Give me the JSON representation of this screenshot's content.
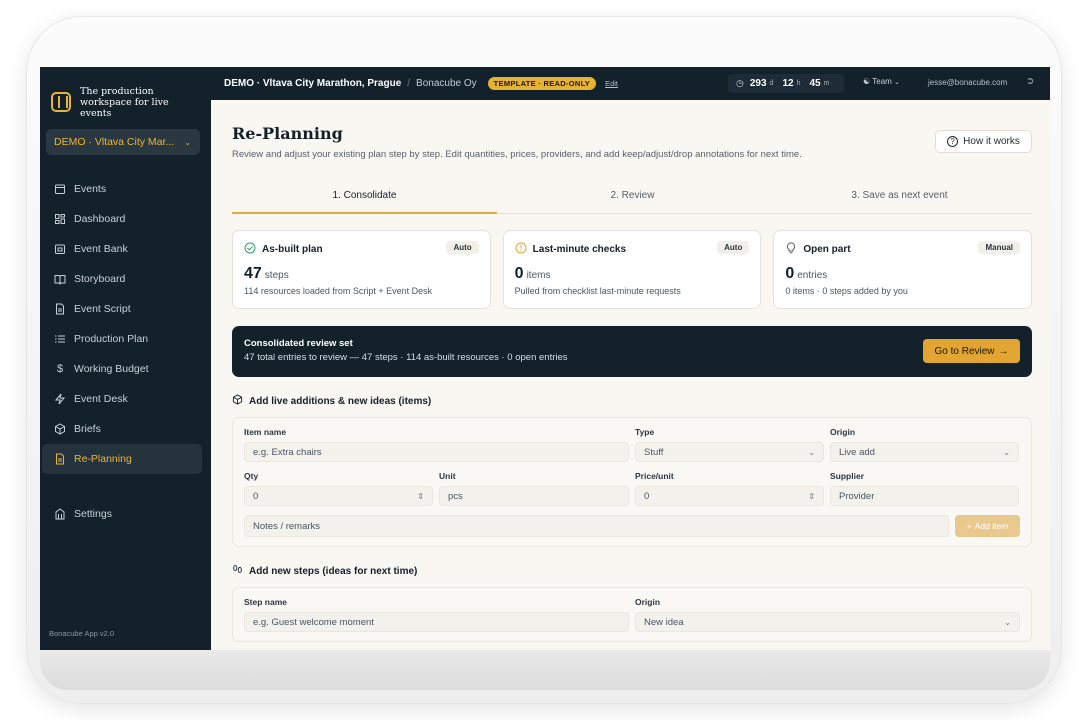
{
  "app": {
    "tagline": "The production workspace for live events",
    "version": "Bonacube App v2.0"
  },
  "sidebar": {
    "event_selector": "DEMO · Vltava City Mar...",
    "items": [
      {
        "label": "Events",
        "icon": "calendar-icon"
      },
      {
        "label": "Dashboard",
        "icon": "dashboard-icon"
      },
      {
        "label": "Event Bank",
        "icon": "bank-icon"
      },
      {
        "label": "Storyboard",
        "icon": "book-icon"
      },
      {
        "label": "Event Script",
        "icon": "document-icon"
      },
      {
        "label": "Production Plan",
        "icon": "list-icon"
      },
      {
        "label": "Working Budget",
        "icon": "dollar-icon"
      },
      {
        "label": "Event Desk",
        "icon": "bolt-icon"
      },
      {
        "label": "Briefs",
        "icon": "box-icon"
      },
      {
        "label": "Re-Planning",
        "icon": "file-icon",
        "active": true
      }
    ],
    "settings": "Settings"
  },
  "topbar": {
    "event": "DEMO · Vltava City Marathon, Prague",
    "separator": "/",
    "org": "Bonacube Oy",
    "template_badge": "TEMPLATE · READ-ONLY",
    "edit": "Edit",
    "countdown": {
      "days": "293",
      "d_unit": "d",
      "hours": "12",
      "h_unit": "h",
      "minutes": "45",
      "m_unit": "m"
    },
    "team": "Team",
    "user_email": "jesse@bonacube.com"
  },
  "page": {
    "title": "Re-Planning",
    "subtitle": "Review and adjust your existing plan step by step. Edit quantities, prices, providers, and add keep/adjust/drop annotations for next time.",
    "how_it_works": "How it works"
  },
  "steps": [
    "1. Consolidate",
    "2. Review",
    "3. Save as next event"
  ],
  "cards": [
    {
      "title": "As-built plan",
      "tag": "Auto",
      "value": "47",
      "unit": "steps",
      "desc": "114 resources loaded from Script + Event Desk",
      "icon_color": "#2f9a6a"
    },
    {
      "title": "Last-minute checks",
      "tag": "Auto",
      "value": "0",
      "unit": "items",
      "desc": "Pulled from checklist last-minute requests",
      "icon_color": "#e2a532"
    },
    {
      "title": "Open part",
      "tag": "Manual",
      "value": "0",
      "unit": "entries",
      "desc": "0 items · 0 steps added by you",
      "icon_color": "#55606a"
    }
  ],
  "review_bar": {
    "title": "Consolidated review set",
    "summary": "47 total entries to review — 47 steps · 114 as-built resources · 0 open entries",
    "button": "Go to Review"
  },
  "items_section": {
    "title": "Add live additions & new ideas (items)",
    "item_name_label": "Item name",
    "item_name_placeholder": "e.g. Extra chairs",
    "type_label": "Type",
    "type_value": "Stuff",
    "origin_label": "Origin",
    "origin_value": "Live add",
    "qty_label": "Qty",
    "qty_value": "0",
    "unit_label": "Unit",
    "unit_placeholder": "pcs",
    "price_label": "Price/unit",
    "price_value": "0",
    "supplier_label": "Supplier",
    "supplier_placeholder": "Provider",
    "notes_placeholder": "Notes / remarks",
    "add_button": "Add item"
  },
  "steps_section": {
    "title": "Add new steps (ideas for next time)",
    "step_name_label": "Step name",
    "step_name_placeholder": "e.g. Guest welcome moment",
    "origin_label": "Origin",
    "origin_value": "New idea"
  },
  "colors": {
    "accent": "#e2a532",
    "sidebar_bg": "#13212b",
    "page_bg": "#f9f7f2"
  }
}
